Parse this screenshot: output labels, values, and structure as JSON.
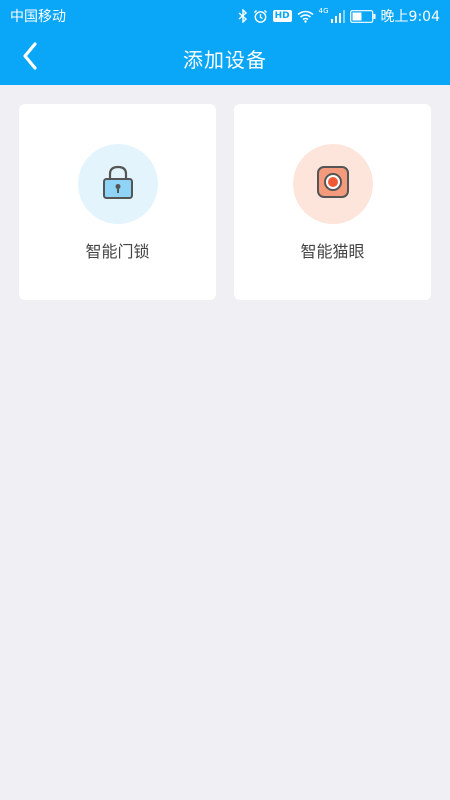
{
  "status_bar": {
    "carrier": "中国移动",
    "hd_badge": "HD",
    "network_badge": "4G",
    "time": "晚上9:04",
    "icons": [
      "bluetooth-icon",
      "alarm-icon",
      "hd-icon",
      "wifi-icon",
      "signal-icon",
      "battery-icon"
    ]
  },
  "nav": {
    "title": "添加设备",
    "back_icon": "chevron-left-icon"
  },
  "devices": [
    {
      "label": "智能门锁",
      "icon": "lock-icon",
      "icon_bg": "#e3f4fd",
      "icon_color": "#8fd3f7"
    },
    {
      "label": "智能猫眼",
      "icon": "peephole-camera-icon",
      "icon_bg": "#fde5dc",
      "icon_color": "#f47f5e"
    }
  ],
  "colors": {
    "primary": "#0aa6f8",
    "background": "#efeff4",
    "card": "#ffffff",
    "text": "#444444"
  }
}
